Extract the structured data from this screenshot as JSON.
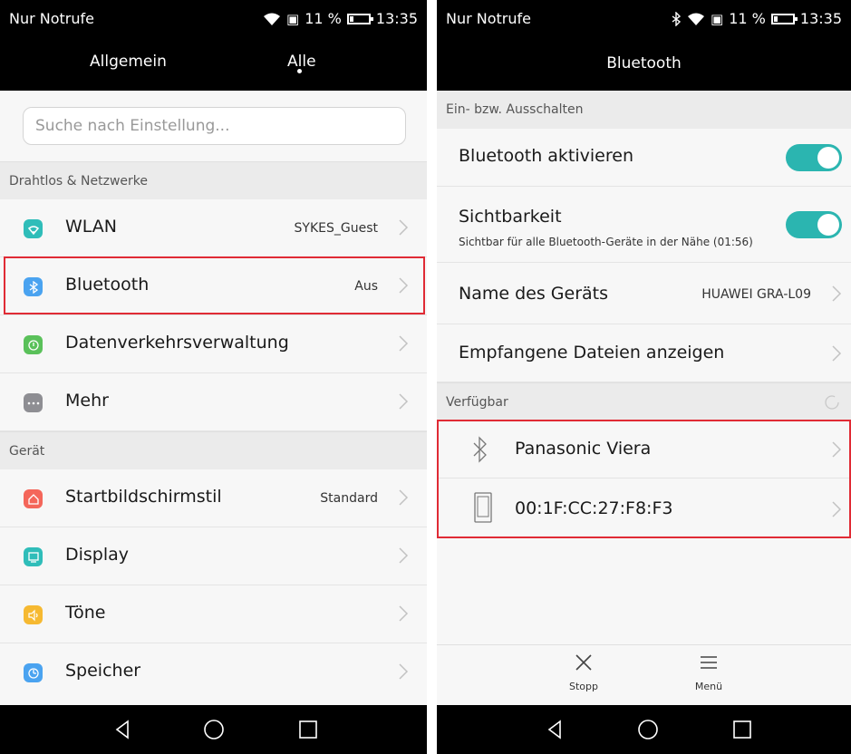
{
  "left_screen": {
    "status": {
      "carrier": "Nur Notrufe",
      "battery": "11 %",
      "time": "13:35"
    },
    "tabs": [
      {
        "label": "Allgemein"
      },
      {
        "label": "Alle"
      }
    ],
    "search": {
      "placeholder": "Suche nach Einstellung..."
    },
    "sections": [
      {
        "title": "Drahtlos & Netzwerke"
      },
      {
        "title": "Gerät"
      }
    ],
    "items": [
      {
        "label": "WLAN",
        "value": "SYKES_Guest",
        "icon": "wifi-icon",
        "color": "#2fbdb9"
      },
      {
        "label": "Bluetooth",
        "value": "Aus",
        "icon": "bluetooth-icon",
        "color": "#4aa3f0"
      },
      {
        "label": "Datenverkehrsverwaltung",
        "value": "",
        "icon": "data-usage-icon",
        "color": "#5ac15a"
      },
      {
        "label": "Mehr",
        "value": "",
        "icon": "more-icon",
        "color": "#8e8e93"
      },
      {
        "label": "Startbildschirmstil",
        "value": "Standard",
        "icon": "home-icon",
        "color": "#f4665a"
      },
      {
        "label": "Display",
        "value": "",
        "icon": "display-icon",
        "color": "#2fbdb9"
      },
      {
        "label": "Töne",
        "value": "",
        "icon": "sound-icon",
        "color": "#f6b931"
      },
      {
        "label": "Speicher",
        "value": "",
        "icon": "storage-icon",
        "color": "#4aa3f0"
      }
    ]
  },
  "right_screen": {
    "status": {
      "carrier": "Nur Notrufe",
      "battery": "11 %",
      "time": "13:35"
    },
    "title": "Bluetooth",
    "sections": [
      {
        "title": "Ein- bzw. Ausschalten"
      },
      {
        "title": "Verfügbar"
      }
    ],
    "toggle_rows": [
      {
        "label": "Bluetooth aktivieren",
        "subtitle": "",
        "on": true
      },
      {
        "label": "Sichtbarkeit",
        "subtitle": "Sichtbar für alle Bluetooth-Geräte in der Nähe (01:56)",
        "on": true
      }
    ],
    "info_rows": [
      {
        "label": "Name des Geräts",
        "value": "HUAWEI GRA-L09"
      },
      {
        "label": "Empfangene Dateien anzeigen",
        "value": ""
      }
    ],
    "devices": [
      {
        "name": "Panasonic Viera",
        "icon": "bluetooth-icon"
      },
      {
        "name": "00:1F:CC:27:F8:F3",
        "icon": "phone-device-icon"
      }
    ],
    "bottom_actions": [
      {
        "label": "Stopp",
        "icon": "close-icon"
      },
      {
        "label": "Menü",
        "icon": "menu-icon"
      }
    ]
  },
  "colors": {
    "accent": "#2bb5b0",
    "highlight": "#e02b35"
  }
}
